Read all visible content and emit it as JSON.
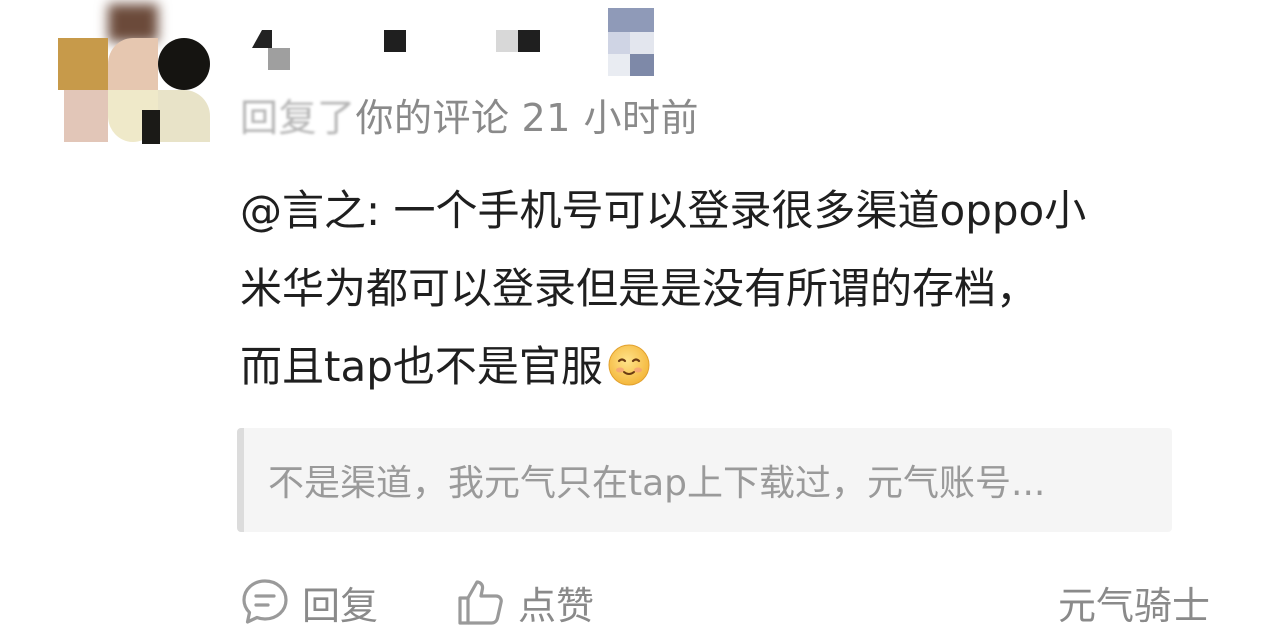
{
  "comment": {
    "meta": {
      "action_blurred": "回复了",
      "target": "你的评论",
      "time": "21 小时前"
    },
    "body_lines": [
      "@言之: 一个手机号可以登录很多渠道oppo小",
      "米华为都可以登录但是是没有所谓的存档，",
      "而且tap也不是官服"
    ],
    "emoji": "smiley-blush-emoji",
    "quoted_text": "不是渠道，我元气只在tap上下载过，元气账号...",
    "actions": {
      "reply_label": "回复",
      "like_label": "点赞"
    },
    "game_tag": "元气骑士"
  },
  "colors": {
    "text_primary": "#1f1f1f",
    "text_secondary": "#8a8a8a",
    "quote_bg": "#f5f5f5",
    "quote_bar": "#dcdcdc"
  }
}
